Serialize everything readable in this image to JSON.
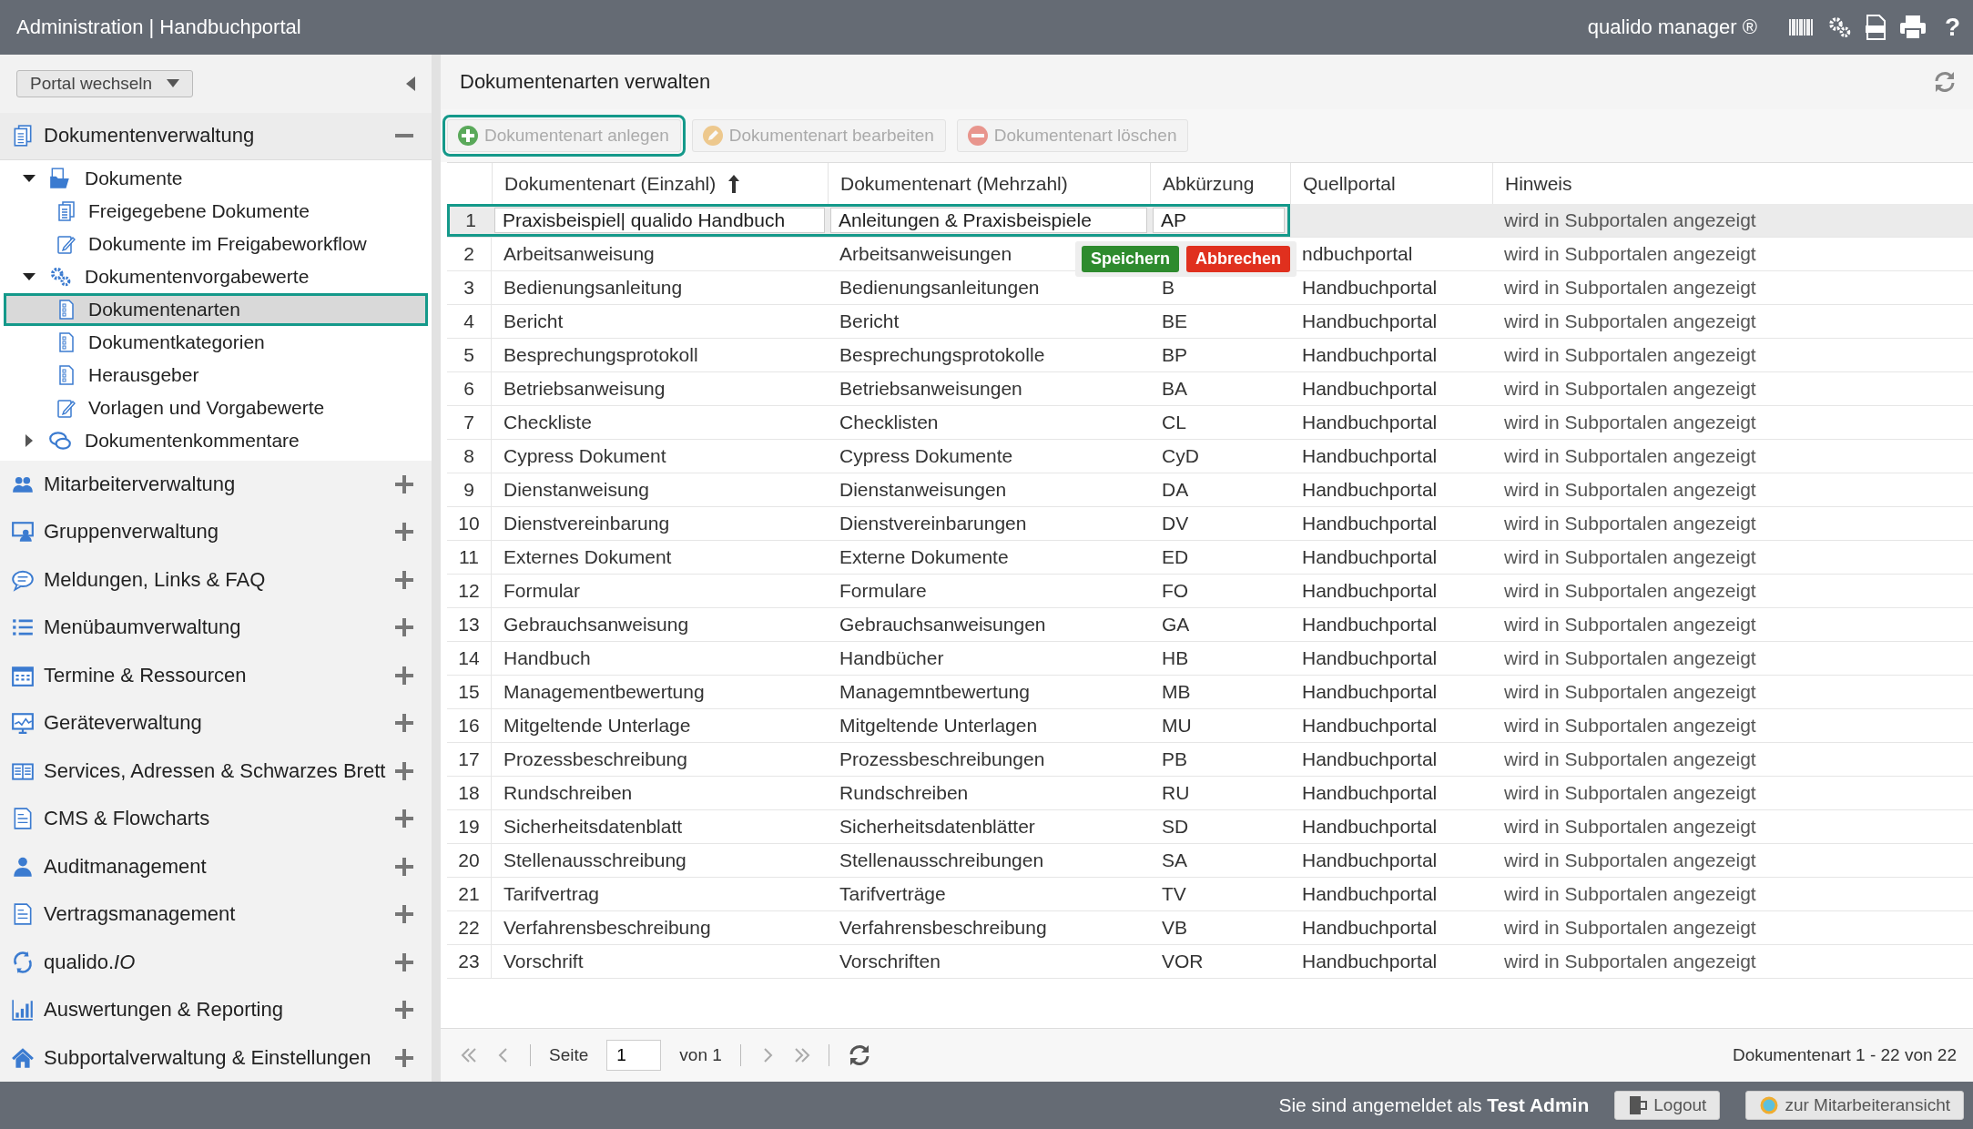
{
  "window": {
    "title": "Administration | Handbuchportal",
    "product": "qualido manager ®",
    "help": "?"
  },
  "sidebar": {
    "portal_switch": "Portal wechseln",
    "sections": [
      {
        "label": "Dokumentenverwaltung",
        "expanded": true,
        "tree": [
          {
            "label": "Dokumente",
            "expanded": true,
            "selected": false,
            "children": [
              {
                "label": "Freigegebene Dokumente",
                "selected": false
              },
              {
                "label": "Dokumente im Freigabeworkflow",
                "selected": false
              }
            ]
          },
          {
            "label": "Dokumentenvorgabewerte",
            "expanded": true,
            "selected": false,
            "children": [
              {
                "label": "Dokumentenarten",
                "selected": true
              },
              {
                "label": "Dokumentkategorien",
                "selected": false
              },
              {
                "label": "Herausgeber",
                "selected": false
              },
              {
                "label": "Vorlagen und Vorgabewerte",
                "selected": false
              }
            ]
          },
          {
            "label": "Dokumentenkommentare",
            "expanded": false,
            "selected": false
          }
        ]
      },
      {
        "label": "Mitarbeiterverwaltung",
        "expanded": false
      },
      {
        "label": "Gruppenverwaltung",
        "expanded": false
      },
      {
        "label": "Meldungen, Links & FAQ",
        "expanded": false
      },
      {
        "label": "Menübaumverwaltung",
        "expanded": false
      },
      {
        "label": "Termine & Ressourcen",
        "expanded": false
      },
      {
        "label": "Geräteverwaltung",
        "expanded": false
      },
      {
        "label": "Services, Adressen & Schwarzes Brett",
        "expanded": false
      },
      {
        "label": "CMS & Flowcharts",
        "expanded": false
      },
      {
        "label": "Auditmanagement",
        "expanded": false
      },
      {
        "label": "Vertragsmanagement",
        "expanded": false
      },
      {
        "label": "qualido.*IO*",
        "expanded": false
      },
      {
        "label": "Auswertungen & Reporting",
        "expanded": false
      },
      {
        "label": "Subportalverwaltung & Einstellungen",
        "expanded": false
      }
    ]
  },
  "main": {
    "title": "Dokumentenarten verwalten",
    "toolbar": [
      {
        "label": "Dokumentenart anlegen",
        "kind": "add",
        "disabled": false,
        "focused": true
      },
      {
        "label": "Dokumentenart bearbeiten",
        "kind": "edit",
        "disabled": true,
        "focused": false
      },
      {
        "label": "Dokumentenart löschen",
        "kind": "delete",
        "disabled": true,
        "focused": false
      }
    ],
    "table": {
      "columns": [
        {
          "label": "Dokumentenart (Einzahl)",
          "sorted": true
        },
        {
          "label": "Dokumentenart (Mehrzahl)",
          "sorted": false
        },
        {
          "label": "Abkürzung",
          "sorted": false
        },
        {
          "label": "Quellportal",
          "sorted": false
        },
        {
          "label": "Hinweis",
          "sorted": false
        }
      ],
      "rows": [
        {
          "number": "1",
          "singular": "Praxisbeispiel| qualido Handbuch",
          "plural": "Anleitungen & Praxisbeispiele",
          "abbreviation": "AP",
          "note": "wird in Subportalen angezeigt",
          "editing": true
        },
        {
          "number": "2",
          "singular": "Arbeitsanweisung",
          "plural": "Arbeitsanweisungen",
          "source_portal": "ndbuchportal",
          "note": "wird in Subportalen angezeigt",
          "editing": false
        },
        {
          "number": "3",
          "singular": "Bedienungsanleitung",
          "plural": "Bedienungsanleitungen",
          "abbreviation": "B",
          "source_portal": "Handbuchportal",
          "note": "wird in Subportalen angezeigt",
          "editing": false
        },
        {
          "number": "4",
          "singular": "Bericht",
          "plural": "Bericht",
          "abbreviation": "BE",
          "source_portal": "Handbuchportal",
          "note": "wird in Subportalen angezeigt",
          "editing": false
        },
        {
          "number": "5",
          "singular": "Besprechungsprotokoll",
          "plural": "Besprechungsprotokolle",
          "abbreviation": "BP",
          "source_portal": "Handbuchportal",
          "note": "wird in Subportalen angezeigt",
          "editing": false
        },
        {
          "number": "6",
          "singular": "Betriebsanweisung",
          "plural": "Betriebsanweisungen",
          "abbreviation": "BA",
          "source_portal": "Handbuchportal",
          "note": "wird in Subportalen angezeigt",
          "editing": false
        },
        {
          "number": "7",
          "singular": "Checkliste",
          "plural": "Checklisten",
          "abbreviation": "CL",
          "source_portal": "Handbuchportal",
          "note": "wird in Subportalen angezeigt",
          "editing": false
        },
        {
          "number": "8",
          "singular": "Cypress Dokument",
          "plural": "Cypress Dokumente",
          "abbreviation": "CyD",
          "source_portal": "Handbuchportal",
          "note": "wird in Subportalen angezeigt",
          "editing": false
        },
        {
          "number": "9",
          "singular": "Dienstanweisung",
          "plural": "Dienstanweisungen",
          "abbreviation": "DA",
          "source_portal": "Handbuchportal",
          "note": "wird in Subportalen angezeigt",
          "editing": false
        },
        {
          "number": "10",
          "singular": "Dienstvereinbarung",
          "plural": "Dienstvereinbarungen",
          "abbreviation": "DV",
          "source_portal": "Handbuchportal",
          "note": "wird in Subportalen angezeigt",
          "editing": false
        },
        {
          "number": "11",
          "singular": "Externes Dokument",
          "plural": "Externe Dokumente",
          "abbreviation": "ED",
          "source_portal": "Handbuchportal",
          "note": "wird in Subportalen angezeigt",
          "editing": false
        },
        {
          "number": "12",
          "singular": "Formular",
          "plural": "Formulare",
          "abbreviation": "FO",
          "source_portal": "Handbuchportal",
          "note": "wird in Subportalen angezeigt",
          "editing": false
        },
        {
          "number": "13",
          "singular": "Gebrauchsanweisung",
          "plural": "Gebrauchsanweisungen",
          "abbreviation": "GA",
          "source_portal": "Handbuchportal",
          "note": "wird in Subportalen angezeigt",
          "editing": false
        },
        {
          "number": "14",
          "singular": "Handbuch",
          "plural": "Handbücher",
          "abbreviation": "HB",
          "source_portal": "Handbuchportal",
          "note": "wird in Subportalen angezeigt",
          "editing": false
        },
        {
          "number": "15",
          "singular": "Managementbewertung",
          "plural": "Managemntbewertung",
          "abbreviation": "MB",
          "source_portal": "Handbuchportal",
          "note": "wird in Subportalen angezeigt",
          "editing": false
        },
        {
          "number": "16",
          "singular": "Mitgeltende Unterlage",
          "plural": "Mitgeltende Unterlagen",
          "abbreviation": "MU",
          "source_portal": "Handbuchportal",
          "note": "wird in Subportalen angezeigt",
          "editing": false
        },
        {
          "number": "17",
          "singular": "Prozessbeschreibung",
          "plural": "Prozessbeschreibungen",
          "abbreviation": "PB",
          "source_portal": "Handbuchportal",
          "note": "wird in Subportalen angezeigt",
          "editing": false
        },
        {
          "number": "18",
          "singular": "Rundschreiben",
          "plural": "Rundschreiben",
          "abbreviation": "RU",
          "source_portal": "Handbuchportal",
          "note": "wird in Subportalen angezeigt",
          "editing": false
        },
        {
          "number": "19",
          "singular": "Sicherheitsdatenblatt",
          "plural": "Sicherheitsdatenblätter",
          "abbreviation": "SD",
          "source_portal": "Handbuchportal",
          "note": "wird in Subportalen angezeigt",
          "editing": false
        },
        {
          "number": "20",
          "singular": "Stellenausschreibung",
          "plural": "Stellenausschreibungen",
          "abbreviation": "SA",
          "source_portal": "Handbuchportal",
          "note": "wird in Subportalen angezeigt",
          "editing": false
        },
        {
          "number": "21",
          "singular": "Tarifvertrag",
          "plural": "Tarifverträge",
          "abbreviation": "TV",
          "source_portal": "Handbuchportal",
          "note": "wird in Subportalen angezeigt",
          "editing": false
        },
        {
          "number": "22",
          "singular": "Verfahrensbeschreibung",
          "plural": "Verfahrensbeschreibung",
          "abbreviation": "VB",
          "source_portal": "Handbuchportal",
          "note": "wird in Subportalen angezeigt",
          "editing": false
        },
        {
          "number": "23",
          "singular": "Vorschrift",
          "plural": "Vorschriften",
          "abbreviation": "VOR",
          "source_portal": "Handbuchportal",
          "note": "wird in Subportalen angezeigt",
          "editing": false
        }
      ]
    },
    "row_actions": [
      {
        "label": "Speichern",
        "kind": "save"
      },
      {
        "label": "Abbrechen",
        "kind": "cancel"
      }
    ],
    "pager": {
      "page_label": "Seite",
      "page": "1",
      "of_label": "von 1",
      "summary": "Dokumentenart 1 - 22 von 22"
    }
  },
  "footer": {
    "login_text": "Sie sind angemeldet als **Test Admin**",
    "logout": "Logout",
    "switch_view": "zur Mitarbeiteransicht"
  }
}
